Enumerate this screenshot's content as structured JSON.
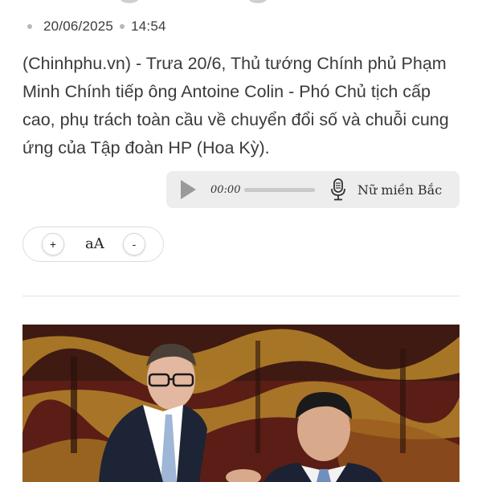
{
  "article": {
    "date": "20/06/2025",
    "time": "14:54",
    "lead": "(Chinhphu.vn) - Trưa 20/6, Thủ tướng Chính phủ Phạm Minh Chính tiếp ông Antoine Colin - Phó Chủ tịch cấp cao, phụ trách toàn cầu về chuyển đổi số và chuỗi cung ứng của Tập đoàn HP (Hoa Kỳ)."
  },
  "audio_player": {
    "current_time": "00:00",
    "progress": 0,
    "voice": "Nữ miền Bắc",
    "icons": {
      "play": "play-icon",
      "voice": "microphone-icon"
    }
  },
  "font_size_control": {
    "increase": "+",
    "label": "aA",
    "decrease": "-"
  },
  "colors": {
    "text": "#3a3a3a",
    "audio_bg": "#ededed",
    "divider": "#e2e2e2"
  }
}
